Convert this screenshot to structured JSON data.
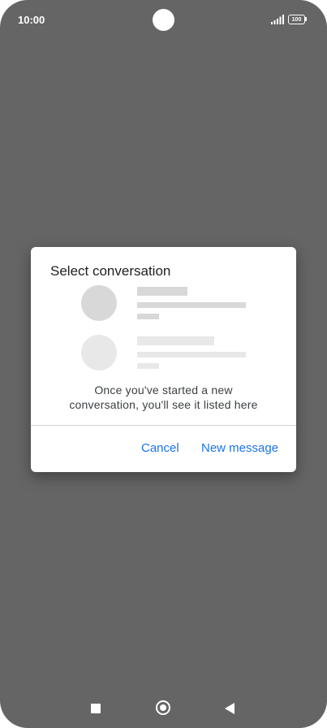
{
  "status_bar": {
    "time": "10:00",
    "battery_level": "100",
    "icons": [
      "front-camera",
      "signal-icon",
      "battery-icon"
    ]
  },
  "dialog": {
    "title": "Select conversation",
    "empty_message": "Once you've started a new conversation, you'll see it listed here",
    "cancel_label": "Cancel",
    "new_message_label": "New message",
    "accent_color": "#1a73e8",
    "placeholder_colors": [
      "#d8d8d8",
      "#e8e8e8"
    ]
  },
  "nav_bar": {
    "icons": [
      "recents-icon",
      "home-icon",
      "back-icon"
    ]
  }
}
